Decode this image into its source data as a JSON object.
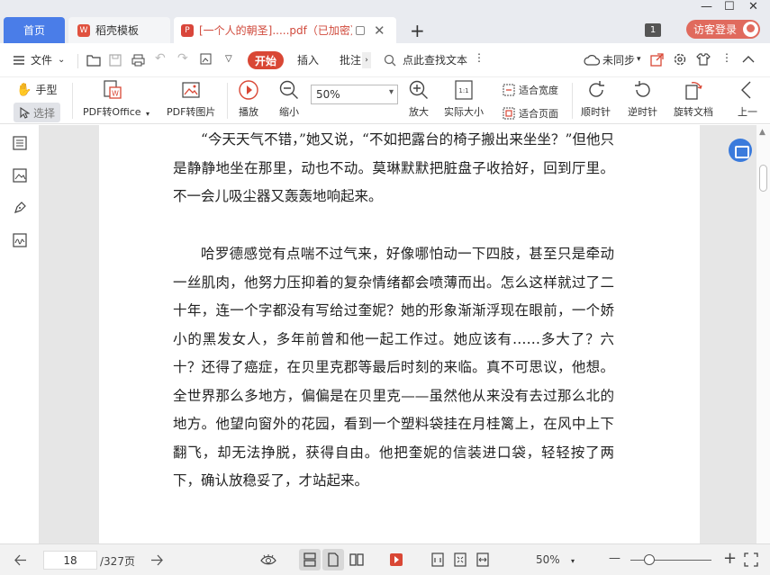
{
  "tabs": {
    "home": "首页",
    "template": "稻壳模板",
    "template_icon": "W",
    "pdf_icon": "P",
    "pdf": "[一个人的朝圣].....pdf（已加密）"
  },
  "window": {
    "minimize": "—",
    "maximize": "☐",
    "close": "✕",
    "badge": "1",
    "login": "访客登录"
  },
  "menubar": {
    "file": "文件",
    "start": "开始",
    "insert": "插入",
    "annotate": "批注",
    "search": "点此查找文本",
    "sync": "未同步"
  },
  "ribbon": {
    "hand": "手型",
    "select": "选择",
    "pdf_to_office": "PDF转Office",
    "pdf_to_image": "PDF转图片",
    "play": "播放",
    "zoom_out": "缩小",
    "zoom_value": "50%",
    "zoom_in": "放大",
    "actual_size": "实际大小",
    "actual_size_icon": "1:1",
    "fit_width": "适合宽度",
    "fit_page": "适合页面",
    "rotate_cw": "顺时针",
    "rotate_ccw": "逆时针",
    "rotate_doc": "旋转文档",
    "prev": "上一"
  },
  "document": {
    "paragraphs": [
      "“今天天气不错，”她又说，“不如把露台的椅子搬出来坐坐？”但他只是静静地坐在那里，动也不动。莫琳默默把脏盘子收拾好，回到厅里。不一会儿吸尘器又轰轰地响起来。",
      "哈罗德感觉有点喘不过气来，好像哪怕动一下四肢，甚至只是牵动一丝肌肉，他努力压抑着的复杂情绪都会喷薄而出。怎么这样就过了二十年，连一个字都没有写给过奎妮？她的形象渐渐浮现在眼前，一个娇小的黑发女人，多年前曾和他一起工作过。她应该有……多大了？六十？还得了癌症，在贝里克郡等最后时刻的来临。真不可思议，他想。全世界那么多地方，偏偏是在贝里克——虽然他从来没有去过那么北的地方。他望向窗外的花园，看到一个塑料袋挂在月桂篱上，在风中上下翻飞，却无法挣脱，获得自由。他把奎妮的信装进口袋，轻轻按了两下，确认放稳妥了，才站起来。"
    ]
  },
  "statusbar": {
    "current_page": "18",
    "total_pages": "/327页",
    "zoom": "50%",
    "zoom_minus": "—",
    "zoom_plus": "+"
  },
  "colors": {
    "accent_blue": "#4a7de8",
    "accent_red": "#d94735",
    "login_red": "#e06a5d"
  }
}
